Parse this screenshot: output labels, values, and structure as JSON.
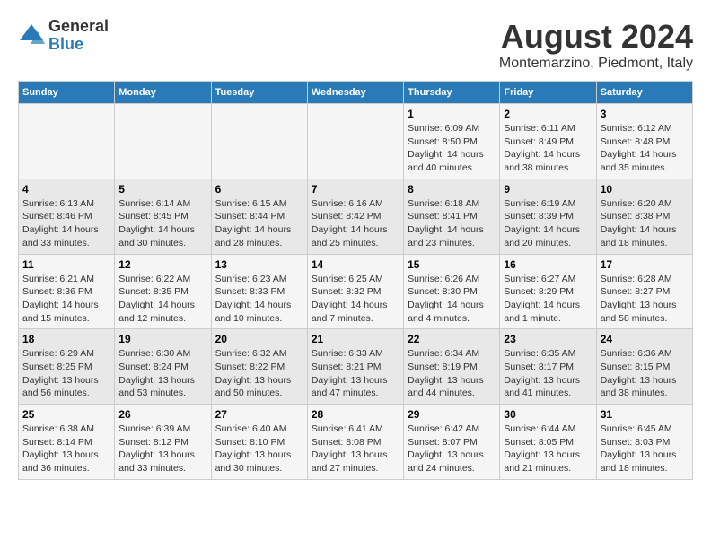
{
  "logo": {
    "general": "General",
    "blue": "Blue"
  },
  "title": "August 2024",
  "subtitle": "Montemarzino, Piedmont, Italy",
  "weekdays": [
    "Sunday",
    "Monday",
    "Tuesday",
    "Wednesday",
    "Thursday",
    "Friday",
    "Saturday"
  ],
  "weeks": [
    [
      {
        "day": "",
        "info": ""
      },
      {
        "day": "",
        "info": ""
      },
      {
        "day": "",
        "info": ""
      },
      {
        "day": "",
        "info": ""
      },
      {
        "day": "1",
        "info": "Sunrise: 6:09 AM\nSunset: 8:50 PM\nDaylight: 14 hours\nand 40 minutes."
      },
      {
        "day": "2",
        "info": "Sunrise: 6:11 AM\nSunset: 8:49 PM\nDaylight: 14 hours\nand 38 minutes."
      },
      {
        "day": "3",
        "info": "Sunrise: 6:12 AM\nSunset: 8:48 PM\nDaylight: 14 hours\nand 35 minutes."
      }
    ],
    [
      {
        "day": "4",
        "info": "Sunrise: 6:13 AM\nSunset: 8:46 PM\nDaylight: 14 hours\nand 33 minutes."
      },
      {
        "day": "5",
        "info": "Sunrise: 6:14 AM\nSunset: 8:45 PM\nDaylight: 14 hours\nand 30 minutes."
      },
      {
        "day": "6",
        "info": "Sunrise: 6:15 AM\nSunset: 8:44 PM\nDaylight: 14 hours\nand 28 minutes."
      },
      {
        "day": "7",
        "info": "Sunrise: 6:16 AM\nSunset: 8:42 PM\nDaylight: 14 hours\nand 25 minutes."
      },
      {
        "day": "8",
        "info": "Sunrise: 6:18 AM\nSunset: 8:41 PM\nDaylight: 14 hours\nand 23 minutes."
      },
      {
        "day": "9",
        "info": "Sunrise: 6:19 AM\nSunset: 8:39 PM\nDaylight: 14 hours\nand 20 minutes."
      },
      {
        "day": "10",
        "info": "Sunrise: 6:20 AM\nSunset: 8:38 PM\nDaylight: 14 hours\nand 18 minutes."
      }
    ],
    [
      {
        "day": "11",
        "info": "Sunrise: 6:21 AM\nSunset: 8:36 PM\nDaylight: 14 hours\nand 15 minutes."
      },
      {
        "day": "12",
        "info": "Sunrise: 6:22 AM\nSunset: 8:35 PM\nDaylight: 14 hours\nand 12 minutes."
      },
      {
        "day": "13",
        "info": "Sunrise: 6:23 AM\nSunset: 8:33 PM\nDaylight: 14 hours\nand 10 minutes."
      },
      {
        "day": "14",
        "info": "Sunrise: 6:25 AM\nSunset: 8:32 PM\nDaylight: 14 hours\nand 7 minutes."
      },
      {
        "day": "15",
        "info": "Sunrise: 6:26 AM\nSunset: 8:30 PM\nDaylight: 14 hours\nand 4 minutes."
      },
      {
        "day": "16",
        "info": "Sunrise: 6:27 AM\nSunset: 8:29 PM\nDaylight: 14 hours\nand 1 minute."
      },
      {
        "day": "17",
        "info": "Sunrise: 6:28 AM\nSunset: 8:27 PM\nDaylight: 13 hours\nand 58 minutes."
      }
    ],
    [
      {
        "day": "18",
        "info": "Sunrise: 6:29 AM\nSunset: 8:25 PM\nDaylight: 13 hours\nand 56 minutes."
      },
      {
        "day": "19",
        "info": "Sunrise: 6:30 AM\nSunset: 8:24 PM\nDaylight: 13 hours\nand 53 minutes."
      },
      {
        "day": "20",
        "info": "Sunrise: 6:32 AM\nSunset: 8:22 PM\nDaylight: 13 hours\nand 50 minutes."
      },
      {
        "day": "21",
        "info": "Sunrise: 6:33 AM\nSunset: 8:21 PM\nDaylight: 13 hours\nand 47 minutes."
      },
      {
        "day": "22",
        "info": "Sunrise: 6:34 AM\nSunset: 8:19 PM\nDaylight: 13 hours\nand 44 minutes."
      },
      {
        "day": "23",
        "info": "Sunrise: 6:35 AM\nSunset: 8:17 PM\nDaylight: 13 hours\nand 41 minutes."
      },
      {
        "day": "24",
        "info": "Sunrise: 6:36 AM\nSunset: 8:15 PM\nDaylight: 13 hours\nand 38 minutes."
      }
    ],
    [
      {
        "day": "25",
        "info": "Sunrise: 6:38 AM\nSunset: 8:14 PM\nDaylight: 13 hours\nand 36 minutes."
      },
      {
        "day": "26",
        "info": "Sunrise: 6:39 AM\nSunset: 8:12 PM\nDaylight: 13 hours\nand 33 minutes."
      },
      {
        "day": "27",
        "info": "Sunrise: 6:40 AM\nSunset: 8:10 PM\nDaylight: 13 hours\nand 30 minutes."
      },
      {
        "day": "28",
        "info": "Sunrise: 6:41 AM\nSunset: 8:08 PM\nDaylight: 13 hours\nand 27 minutes."
      },
      {
        "day": "29",
        "info": "Sunrise: 6:42 AM\nSunset: 8:07 PM\nDaylight: 13 hours\nand 24 minutes."
      },
      {
        "day": "30",
        "info": "Sunrise: 6:44 AM\nSunset: 8:05 PM\nDaylight: 13 hours\nand 21 minutes."
      },
      {
        "day": "31",
        "info": "Sunrise: 6:45 AM\nSunset: 8:03 PM\nDaylight: 13 hours\nand 18 minutes."
      }
    ]
  ]
}
